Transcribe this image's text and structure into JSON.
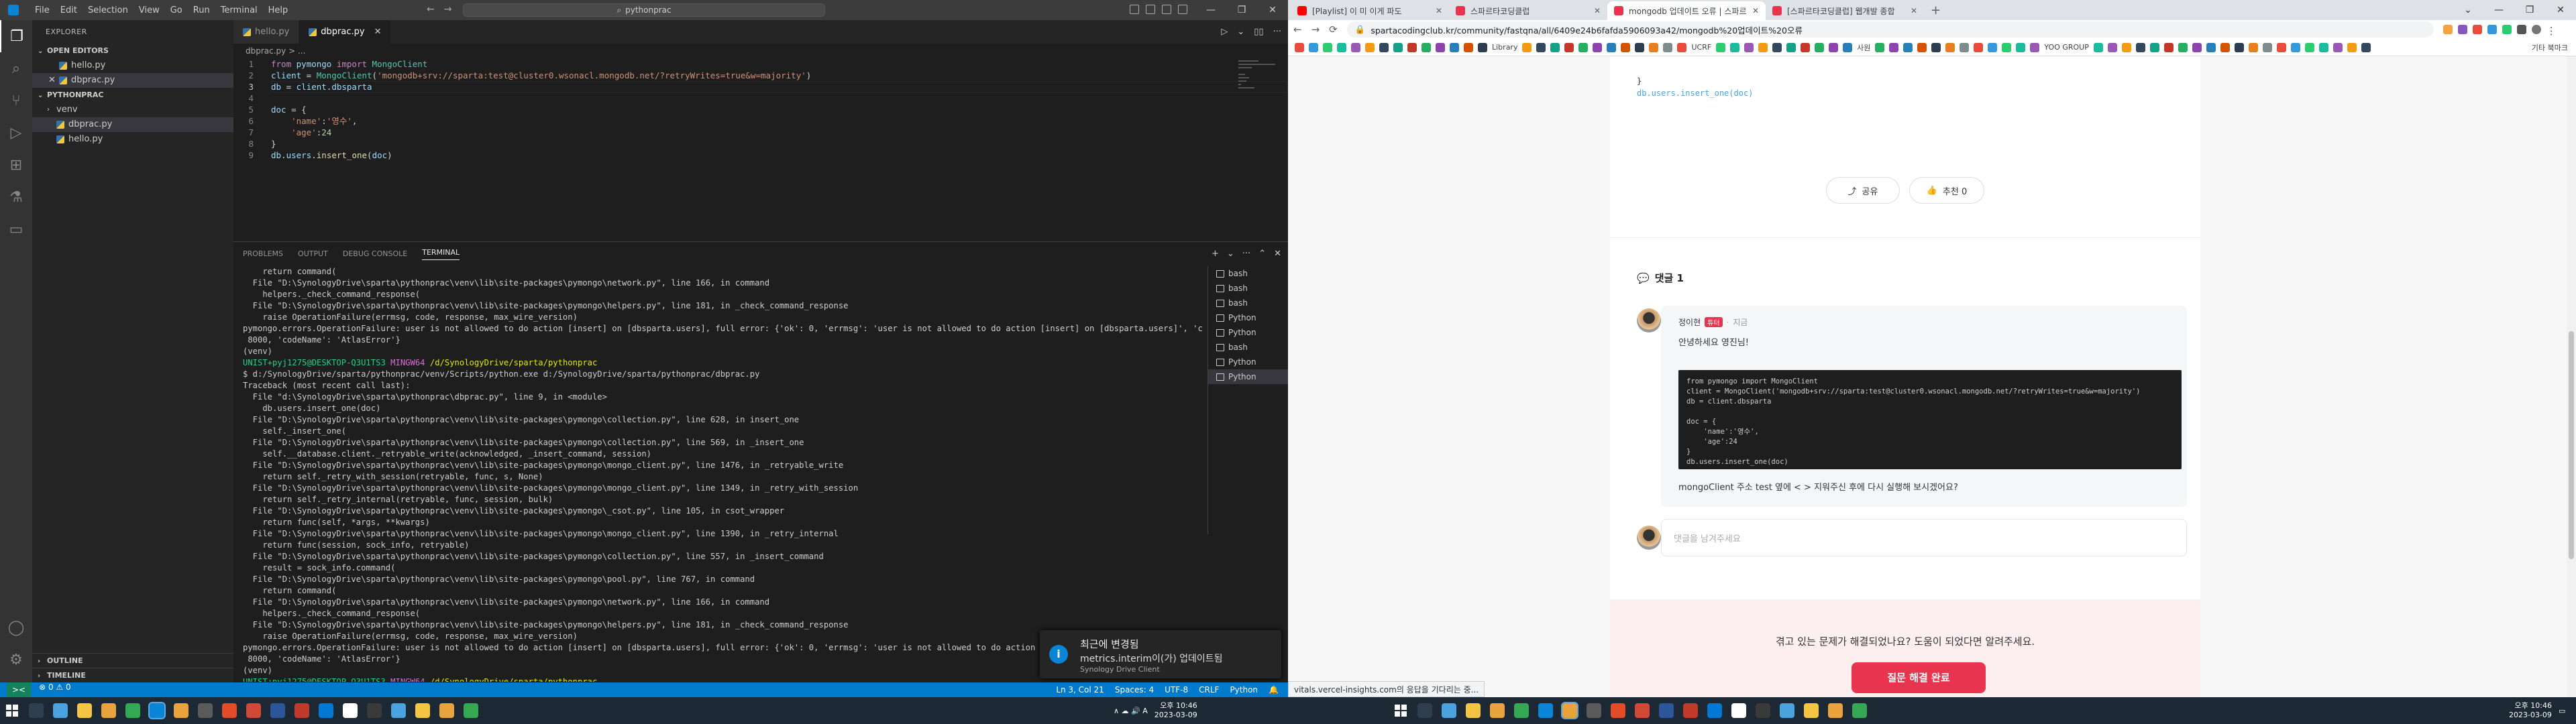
{
  "vscode": {
    "menu": [
      "File",
      "Edit",
      "Selection",
      "View",
      "Go",
      "Run",
      "Terminal",
      "Help"
    ],
    "command_center": "pythonprac",
    "sidebar": {
      "title": "EXPLORER",
      "open_editors": "OPEN EDITORS",
      "open_files": [
        "hello.py",
        "dbprac.py"
      ],
      "project": "PYTHONPRAC",
      "tree": [
        {
          "name": "venv",
          "type": "folder"
        },
        {
          "name": "dbprac.py",
          "type": "file"
        },
        {
          "name": "hello.py",
          "type": "file"
        }
      ],
      "outline": "OUTLINE",
      "timeline": "TIMELINE"
    },
    "tabs": [
      {
        "label": "hello.py",
        "active": false
      },
      {
        "label": "dbprac.py",
        "active": true
      }
    ],
    "breadcrumb": "dbprac.py > ...",
    "code": [
      "from pymongo import MongoClient",
      "client = MongoClient('mongodb+srv://sparta:test@cluster0.wsonacl.mongodb.net/?retryWrites=true&w=majority')",
      "db = client.dbsparta",
      "",
      "doc = {",
      "    'name':'영수',",
      "    'age':24",
      "}",
      "db.users.insert_one(doc)"
    ],
    "panel_tabs": [
      "PROBLEMS",
      "OUTPUT",
      "DEBUG CONSOLE",
      "TERMINAL"
    ],
    "terminal_lines": [
      "    return command(",
      "  File \"D:\\SynologyDrive\\sparta\\pythonprac\\venv\\lib\\site-packages\\pymongo\\network.py\", line 166, in command",
      "    helpers._check_command_response(",
      "  File \"D:\\SynologyDrive\\sparta\\pythonprac\\venv\\lib\\site-packages\\pymongo\\helpers.py\", line 181, in _check_command_response",
      "    raise OperationFailure(errmsg, code, response, max_wire_version)",
      "pymongo.errors.OperationFailure: user is not allowed to do action [insert] on [dbsparta.users], full error: {'ok': 0, 'errmsg': 'user is not allowed to do action [insert] on [dbsparta.users]', 'code':",
      " 8000, 'codeName': 'AtlasError'}",
      "(venv)",
      "PROMPT1",
      "$ d:/SynologyDrive/sparta/pythonprac/venv/Scripts/python.exe d:/SynologyDrive/sparta/pythonprac/dbprac.py",
      "Traceback (most recent call last):",
      "  File \"d:\\SynologyDrive\\sparta\\pythonprac\\dbprac.py\", line 9, in <module>",
      "    db.users.insert_one(doc)",
      "  File \"D:\\SynologyDrive\\sparta\\pythonprac\\venv\\lib\\site-packages\\pymongo\\collection.py\", line 628, in insert_one",
      "    self._insert_one(",
      "  File \"D:\\SynologyDrive\\sparta\\pythonprac\\venv\\lib\\site-packages\\pymongo\\collection.py\", line 569, in _insert_one",
      "    self.__database.client._retryable_write(acknowledged, _insert_command, session)",
      "  File \"D:\\SynologyDrive\\sparta\\pythonprac\\venv\\lib\\site-packages\\pymongo\\mongo_client.py\", line 1476, in _retryable_write",
      "    return self._retry_with_session(retryable, func, s, None)",
      "  File \"D:\\SynologyDrive\\sparta\\pythonprac\\venv\\lib\\site-packages\\pymongo\\mongo_client.py\", line 1349, in _retry_with_session",
      "    return self._retry_internal(retryable, func, session, bulk)",
      "  File \"D:\\SynologyDrive\\sparta\\pythonprac\\venv\\lib\\site-packages\\pymongo\\_csot.py\", line 105, in csot_wrapper",
      "    return func(self, *args, **kwargs)",
      "  File \"D:\\SynologyDrive\\sparta\\pythonprac\\venv\\lib\\site-packages\\pymongo\\mongo_client.py\", line 1390, in _retry_internal",
      "    return func(session, sock_info, retryable)",
      "  File \"D:\\SynologyDrive\\sparta\\pythonprac\\venv\\lib\\site-packages\\pymongo\\collection.py\", line 557, in _insert_command",
      "    result = sock_info.command(",
      "  File \"D:\\SynologyDrive\\sparta\\pythonprac\\venv\\lib\\site-packages\\pymongo\\pool.py\", line 767, in command",
      "    return command(",
      "  File \"D:\\SynologyDrive\\sparta\\pythonprac\\venv\\lib\\site-packages\\pymongo\\network.py\", line 166, in command",
      "    helpers._check_command_response(",
      "  File \"D:\\SynologyDrive\\sparta\\pythonprac\\venv\\lib\\site-packages\\pymongo\\helpers.py\", line 181, in _check_command_response",
      "    raise OperationFailure(errmsg, code, response, max_wire_version)",
      "pymongo.errors.OperationFailure: user is not allowed to do action [insert] on [dbsparta.users], full error: {'ok': 0, 'errmsg': 'user is not allowed to do action [insert",
      " 8000, 'codeName': 'AtlasError'}",
      "(venv)",
      "PROMPT2",
      "$ "
    ],
    "prompt_user": "UNIST+pyj1275@DESKTOP-Q3U1TS3",
    "prompt_shell": "MINGW64",
    "prompt_path": "/d/SynologyDrive/sparta/pythonprac",
    "terminal_list": [
      "bash",
      "bash",
      "bash",
      "Python",
      "Python",
      "bash",
      "Python",
      "Python"
    ],
    "notification": {
      "title": "최근에 변경됨",
      "body": "metrics.interim이(가) 업데이트됨",
      "source": "Synology Drive Client"
    },
    "status": {
      "ln_col": "Ln 3, Col 21",
      "spaces": "Spaces: 4",
      "encoding": "UTF-8",
      "eol": "CRLF",
      "lang": "Python"
    }
  },
  "chrome": {
    "tabs": [
      {
        "label": "[Playlist] 이 미 이게 파도",
        "color": "#ff0000"
      },
      {
        "label": "스파르타코딩클럽",
        "color": "#e8344e"
      },
      {
        "label": "mongodb 업데이트 오류 | 스파르",
        "color": "#e8344e",
        "active": true
      },
      {
        "label": "[스파르타코딩클럽] 웹개발 종합",
        "color": "#e8344e"
      }
    ],
    "url": "spartacodingclub.kr/community/fastqna/all/6409e24b6fafda5906093a42/mongodb%20업데이트%20오류",
    "bookmark_labels": [
      "Library",
      "UCRF",
      "사원",
      "YOO GROUP",
      "기타 북마크"
    ],
    "page": {
      "code_fragment_1": "}",
      "code_fragment_2": "db.users.insert_one(doc)",
      "share": "공유",
      "recommend": "추천 0",
      "comments_title": "댓글 1",
      "comment": {
        "author": "정이현",
        "badge": "튜터",
        "time": "지금",
        "greeting": "안녕하세요 영진님!",
        "question": "mongoClient 주소 test 옆에 < > 지워주신 후에 다시 실행해 보시겠어요?",
        "code": [
          "from pymongo import MongoClient",
          "client = MongoClient('mongodb+srv://sparta:test@cluster0.wsonacl.mongodb.net/?retryWrites=true&w=majority')",
          "db = client.dbsparta",
          "",
          "doc = {",
          "    'name':'영수',",
          "    'age':24",
          "}",
          "db.users.insert_one(doc)"
        ]
      },
      "reply_placeholder": "댓글을 남겨주세요",
      "resolve_question": "겪고 있는 문제가 해결되었나요? 도움이 되었다면 알려주세요.",
      "resolve_button": "질문 해결 완료",
      "hover_url": "vitals.vercel-insights.com의 응답을 기다리는 중..."
    }
  },
  "taskbar": {
    "left_clock": {
      "time": "오후 10:46",
      "date": "2023-03-09"
    },
    "right_clock": {
      "time": "오후 10:46",
      "date": "2023-03-09"
    }
  }
}
